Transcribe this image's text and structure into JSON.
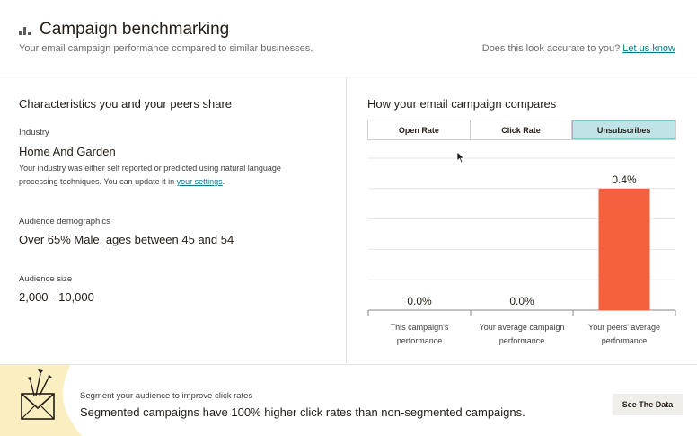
{
  "header": {
    "title": "Campaign benchmarking",
    "subtitle": "Your email campaign performance compared to similar businesses.",
    "feedback_question": "Does this look accurate to you?",
    "feedback_link": "Let us know",
    "icon": "bar-chart-icon"
  },
  "characteristics": {
    "title": "Characteristics you and your peers share",
    "industry_label": "Industry",
    "industry_value": "Home And Garden",
    "industry_note": "Your industry was either self reported or predicted using natural language processing techniques. You can update it in",
    "industry_note_link": "your settings",
    "industry_note_end": ".",
    "demographics_label": "Audience demographics",
    "demographics_value": "Over 65% Male, ages between 45 and 54",
    "size_label": "Audience size",
    "size_value": "2,000 - 10,000"
  },
  "comparison": {
    "title": "How your email campaign compares",
    "tabs": [
      "Open Rate",
      "Click Rate",
      "Unsubscribes"
    ],
    "active_tab": "Unsubscribes"
  },
  "chart_data": {
    "type": "bar",
    "categories": [
      [
        "This campaign's",
        "performance"
      ],
      [
        "Your average campaign",
        "performance"
      ],
      [
        "Your peers' average",
        "performance"
      ]
    ],
    "values": [
      0.0,
      0.0,
      0.4
    ],
    "value_labels": [
      "0.0%",
      "0.0%",
      "0.4%"
    ],
    "ylim": [
      0,
      0.5
    ],
    "grid": true,
    "bar_color": "#f5613f",
    "title": "",
    "xlabel": "",
    "ylabel": ""
  },
  "banner": {
    "kicker": "Segment your audience to improve click rates",
    "text": "Segmented campaigns have 100% higher click rates than non-segmented campaigns.",
    "button": "See The Data",
    "accent": "#fbeec0"
  },
  "colors": {
    "link": "#007c89",
    "tab_active_bg": "#bfe3e6",
    "bar": "#f5613f"
  }
}
